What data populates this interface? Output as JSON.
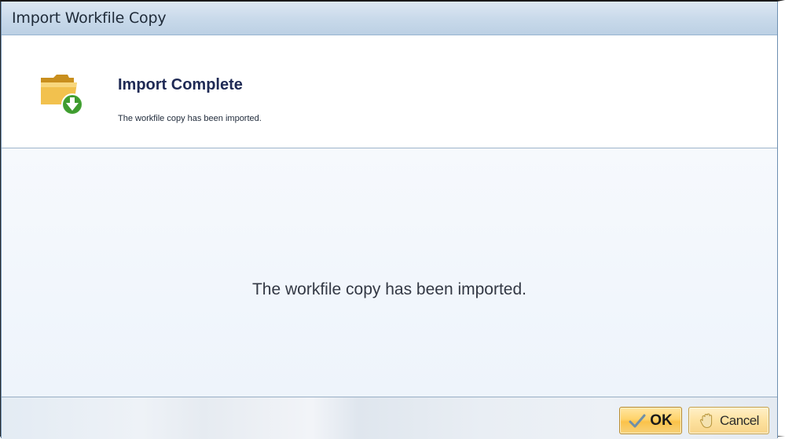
{
  "window": {
    "title": "Import Workfile Copy"
  },
  "banner": {
    "icon": "folder-import-icon",
    "title": "Import Complete",
    "subtitle": "The workfile copy has been imported."
  },
  "body": {
    "message": "The workfile copy has been imported."
  },
  "footer": {
    "ok_label": "OK",
    "ok_icon": "checkmark-icon",
    "cancel_label": "Cancel",
    "cancel_icon": "hand-stop-icon"
  },
  "colors": {
    "title_text": "#1f2a55",
    "button_gold": "#ffd36a",
    "folder_yellow": "#e8b43a",
    "arrow_green": "#3f9b2f"
  }
}
